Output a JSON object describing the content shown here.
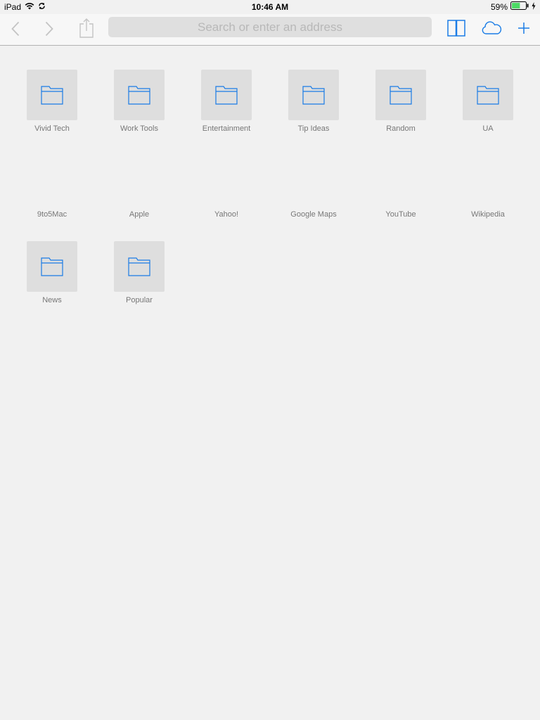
{
  "status": {
    "device": "iPad",
    "time": "10:46 AM",
    "battery": "59%"
  },
  "toolbar": {
    "address_placeholder": "Search or enter an address"
  },
  "colors": {
    "accent": "#1a7ce6",
    "disabled": "#c4c4c4"
  },
  "favorites": [
    {
      "label": "Vivid Tech",
      "type": "folder"
    },
    {
      "label": "Work Tools",
      "type": "folder"
    },
    {
      "label": "Entertainment",
      "type": "folder"
    },
    {
      "label": "Tip Ideas",
      "type": "folder"
    },
    {
      "label": "Random",
      "type": "folder"
    },
    {
      "label": "UA",
      "type": "folder"
    },
    {
      "label": "9to5Mac",
      "type": "site"
    },
    {
      "label": "Apple",
      "type": "site"
    },
    {
      "label": "Yahoo!",
      "type": "site"
    },
    {
      "label": "Google Maps",
      "type": "site"
    },
    {
      "label": "YouTube",
      "type": "site"
    },
    {
      "label": "Wikipedia",
      "type": "site"
    },
    {
      "label": "News",
      "type": "folder"
    },
    {
      "label": "Popular",
      "type": "folder"
    }
  ]
}
